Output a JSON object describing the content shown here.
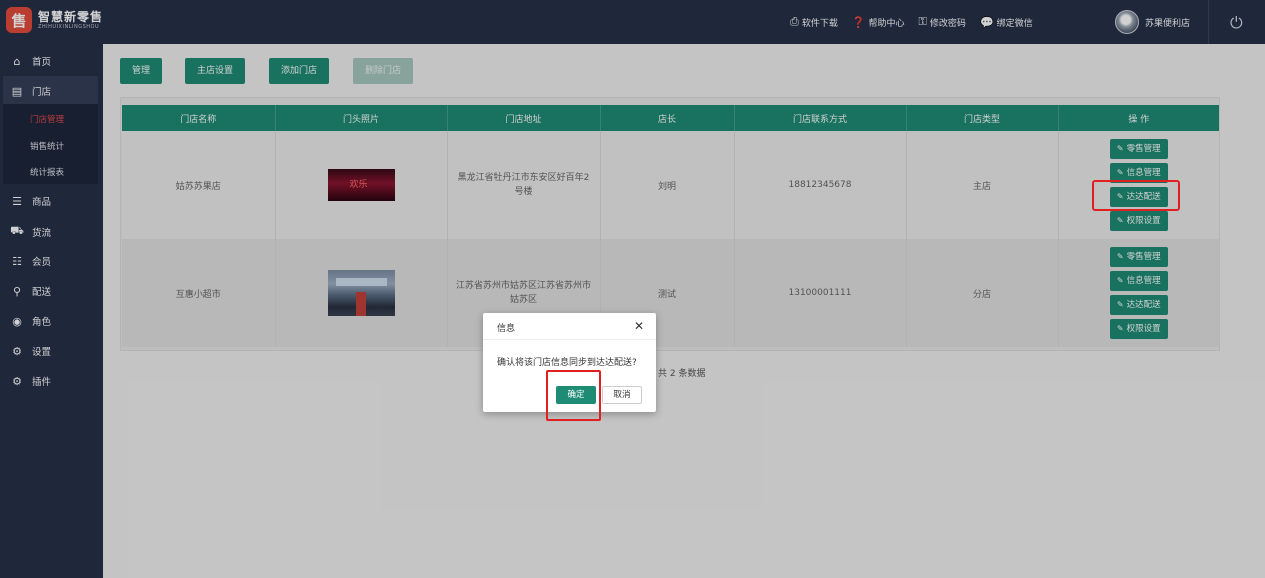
{
  "brand": {
    "name": "智慧新零售",
    "subtitle": "ZHIHUIXINLINGSHOU",
    "mark": "售"
  },
  "header": {
    "links": [
      {
        "icon": "⎙",
        "label": "软件下载"
      },
      {
        "icon": "❓",
        "label": "帮助中心"
      },
      {
        "icon": "⚿",
        "label": "修改密码"
      },
      {
        "icon": "💬",
        "label": "绑定微信"
      }
    ],
    "user_name": "苏果便利店",
    "power_icon": "⏻"
  },
  "sidebar": {
    "items": [
      {
        "icon": "⌂",
        "label": "首页"
      },
      {
        "icon": "▤",
        "label": "门店"
      },
      {
        "icon": "☰",
        "label": "商品"
      },
      {
        "icon": "⛟",
        "label": "货流"
      },
      {
        "icon": "☷",
        "label": "会员"
      },
      {
        "icon": "⚲",
        "label": "配送"
      },
      {
        "icon": "◉",
        "label": "角色"
      },
      {
        "icon": "⚙",
        "label": "设置"
      },
      {
        "icon": "⚙",
        "label": "插件"
      }
    ],
    "submenu": [
      {
        "label": "门店管理"
      },
      {
        "label": "销售统计"
      },
      {
        "label": "统计报表"
      }
    ]
  },
  "toolbar": {
    "manage": "管理",
    "main_store_settings": "主店设置",
    "add_store": "添加门店",
    "delete_store": "删除门店"
  },
  "table": {
    "headers": [
      "门店名称",
      "门头照片",
      "门店地址",
      "店长",
      "门店联系方式",
      "门店类型",
      "操 作"
    ],
    "rows": [
      {
        "name": "姑苏苏果店",
        "photo_text": "欢乐",
        "address": "黑龙江省牡丹江市东安区好百年2号楼",
        "manager": "刘明",
        "phone": "18812345678",
        "type": "主店"
      },
      {
        "name": "互惠小超市",
        "photo_text": "",
        "address": "江苏省苏州市姑苏区江苏省苏州市姑苏区",
        "manager": "测试",
        "phone": "13100001111",
        "type": "分店"
      }
    ],
    "actions": [
      "零售管理",
      "信息管理",
      "达达配送",
      "权限设置"
    ],
    "action_icon": "✎"
  },
  "pagination": {
    "total": "共 2 条数据"
  },
  "dialog": {
    "title": "信息",
    "close": "✕",
    "message": "确认将该门店信息同步到达达配送?",
    "ok": "确定",
    "cancel": "取消"
  },
  "colors": {
    "primary": "#1e8b74",
    "sidebar": "#263049",
    "highlight": "#e02020",
    "active_sub": "#e0484a"
  }
}
